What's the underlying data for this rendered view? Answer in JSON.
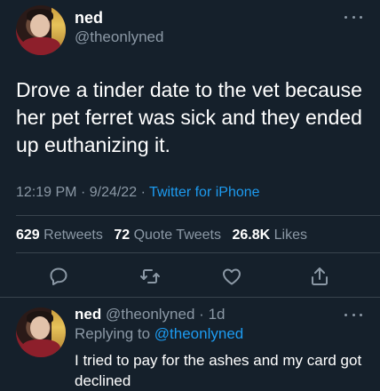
{
  "tweet": {
    "name": "ned",
    "handle": "@theonlyned",
    "text": "Drove a tinder date to the vet because her pet ferret was sick and they ended up euthanizing it.",
    "time": "12:19 PM",
    "date": "9/24/22",
    "separator": "·",
    "source": "Twitter for iPhone"
  },
  "stats": {
    "retweets_count": "629",
    "retweets_label": "Retweets",
    "quotes_count": "72",
    "quotes_label": "Quote Tweets",
    "likes_count": "26.8K",
    "likes_label": "Likes"
  },
  "actions": [
    "reply-icon",
    "retweet-icon",
    "like-icon",
    "share-icon"
  ],
  "reply": {
    "name": "ned",
    "handle": "@theonlyned",
    "age": "1d",
    "separator": "·",
    "replying_prefix": "Replying to",
    "replying_to": "@theonlyned",
    "text": "I tried to pay for the ashes and my card got declined"
  },
  "colors": {
    "background": "#15202b",
    "secondary_text": "#8b98a5",
    "link": "#1d9bf0",
    "divider": "#38444d"
  }
}
